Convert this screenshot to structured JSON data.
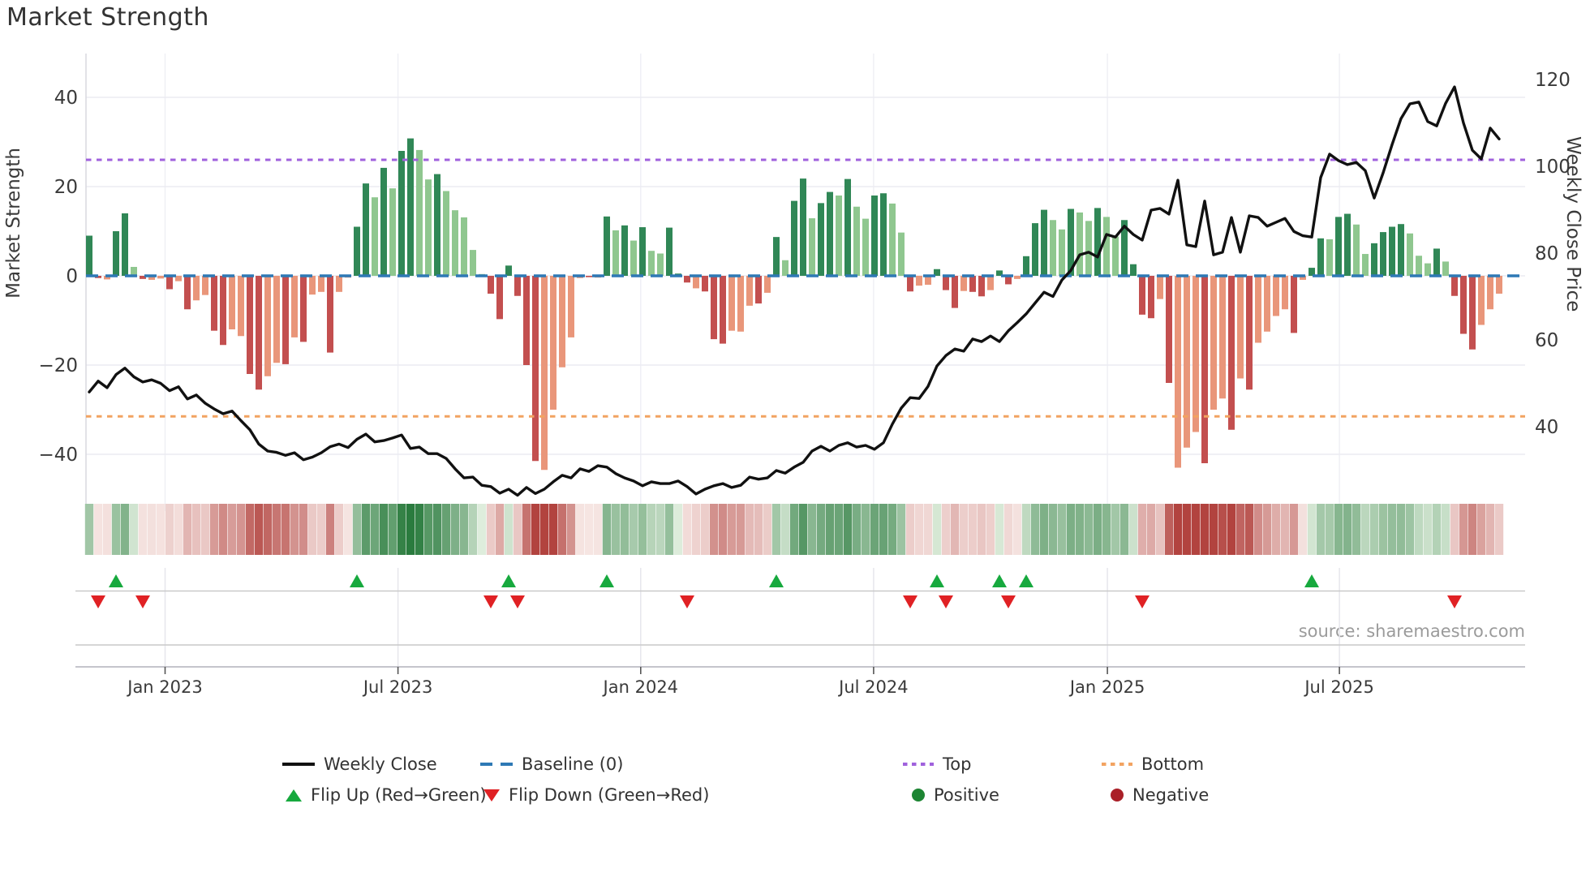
{
  "page": {
    "title": "Market Strength",
    "source": "source: sharemaestro.com"
  },
  "chart_data": {
    "type": "bar",
    "subtype": "combo-bar-line-heatmap",
    "title": "Market Strength",
    "left_axis": {
      "label": "Market Strength",
      "ticks": [
        40,
        20,
        0,
        -20,
        -40
      ],
      "tick_labels": [
        "40",
        "20",
        "0",
        "−20",
        "−40"
      ],
      "ylim": [
        -52,
        50
      ]
    },
    "right_axis": {
      "label": "Weekly Close Price",
      "ticks": [
        120,
        100,
        80,
        60,
        40
      ],
      "tick_labels": [
        "120",
        "100",
        "80",
        "60",
        "40"
      ],
      "ylim": [
        22,
        126
      ]
    },
    "x_axis": {
      "tick_labels": [
        "Jan 2023",
        "Jul 2023",
        "Jan 2024",
        "Jul 2024",
        "Jan 2025",
        "Jul 2025"
      ],
      "tick_weeks": [
        8.5,
        34.6,
        61.8,
        87.9,
        114.1,
        140.1
      ],
      "start_week_label": "Nov 2022",
      "weeks_total": 159
    },
    "reference_lines": {
      "baseline": 0,
      "top": 26,
      "bottom": -31.5
    },
    "bars": {
      "values": [
        9,
        -0.5,
        -0.8,
        10,
        14,
        2,
        -0.7,
        -0.9,
        -0.6,
        -3,
        -1.2,
        -7.5,
        -5.5,
        -4.3,
        -12.3,
        -15.5,
        -12,
        -13.5,
        -22,
        -25.5,
        -22.5,
        -19.5,
        -19.8,
        -13.8,
        -14.8,
        -4.2,
        -3.6,
        -17.2,
        -3.6,
        -0.4,
        11,
        20.7,
        17.6,
        24.2,
        19.6,
        28,
        30.8,
        28.2,
        21.6,
        22.8,
        19,
        14.7,
        13.1,
        5.8,
        0.4,
        -4,
        -9.7,
        2.3,
        -4.5,
        -20,
        -41.5,
        -43.5,
        -30,
        -20.5,
        -13.8,
        -0.5,
        -0.3,
        -0.4,
        13.3,
        10.2,
        11.3,
        7.9,
        10.9,
        5.6,
        5,
        10.8,
        0.5,
        -1.5,
        -2.8,
        -3.5,
        -14.2,
        -15.2,
        -12.3,
        -12.5,
        -6.7,
        -6.2,
        -3.8,
        8.7,
        3.5,
        16.8,
        21.8,
        12.9,
        16.3,
        18.8,
        18,
        21.7,
        15.5,
        12.8,
        18,
        18.5,
        16.2,
        9.7,
        -3.5,
        -2.2,
        -2,
        1.5,
        -3.2,
        -7.2,
        -3.4,
        -3.6,
        -4.6,
        -3.2,
        1.2,
        -1.9,
        -0.7,
        4.4,
        11.8,
        14.8,
        12.5,
        10.4,
        15,
        14.2,
        12.3,
        15.2,
        13.2,
        8.8,
        12.5,
        2.6,
        -8.7,
        -9.5,
        -5.2,
        -24,
        -43,
        -38.5,
        -35,
        -42,
        -30,
        -27.5,
        -34.5,
        -23,
        -25.5,
        -15,
        -12.5,
        -9,
        -7.5,
        -12.8,
        -0.9,
        1.8,
        8.4,
        8.2,
        13.2,
        13.9,
        11.5,
        4.9,
        7.3,
        9.8,
        11,
        11.6,
        9.5,
        4.5,
        2.8,
        6.1,
        3.2,
        -4.5,
        -13,
        -16.5,
        -11,
        -7.5,
        -4
      ],
      "shades": [
        "d",
        "d",
        "l",
        "d",
        "d",
        "l",
        "d",
        "l",
        "l",
        "d",
        "l",
        "d",
        "l",
        "l",
        "d",
        "d",
        "l",
        "l",
        "d",
        "d",
        "l",
        "l",
        "d",
        "l",
        "d",
        "l",
        "l",
        "d",
        "l",
        "l",
        "d",
        "d",
        "l",
        "d",
        "l",
        "d",
        "d",
        "l",
        "l",
        "d",
        "l",
        "l",
        "l",
        "l",
        "l",
        "d",
        "d",
        "d",
        "d",
        "d",
        "d",
        "l",
        "l",
        "l",
        "l",
        "l",
        "d",
        "l",
        "d",
        "l",
        "d",
        "l",
        "d",
        "l",
        "l",
        "d",
        "d",
        "d",
        "l",
        "d",
        "d",
        "d",
        "l",
        "l",
        "l",
        "d",
        "l",
        "d",
        "l",
        "d",
        "d",
        "l",
        "d",
        "d",
        "l",
        "d",
        "l",
        "l",
        "d",
        "d",
        "l",
        "l",
        "d",
        "l",
        "l",
        "d",
        "d",
        "d",
        "l",
        "d",
        "d",
        "l",
        "d",
        "d",
        "l",
        "d",
        "d",
        "d",
        "l",
        "l",
        "d",
        "l",
        "l",
        "d",
        "l",
        "l",
        "d",
        "d",
        "d",
        "d",
        "l",
        "d",
        "l",
        "l",
        "l",
        "d",
        "l",
        "l",
        "d",
        "l",
        "d",
        "l",
        "l",
        "l",
        "l",
        "d",
        "l",
        "d",
        "d",
        "l",
        "d",
        "d",
        "l",
        "l",
        "d",
        "d",
        "d",
        "d",
        "l",
        "l",
        "l",
        "d",
        "l",
        "d",
        "d",
        "d",
        "l",
        "l",
        "l"
      ]
    },
    "weekly_close": [
      48,
      50.5,
      49,
      52,
      53.5,
      51.5,
      50.3,
      50.8,
      50,
      48.3,
      49.2,
      46.4,
      47.3,
      45.4,
      44.1,
      43,
      43.6,
      41.4,
      39.3,
      36,
      34.4,
      34.1,
      33.4,
      34,
      32.4,
      33,
      34,
      35.4,
      36,
      35.2,
      37.1,
      38.3,
      36.5,
      36.8,
      37.4,
      38.1,
      35,
      35.3,
      33.8,
      33.8,
      32.7,
      30.3,
      28.2,
      28.4,
      26.5,
      26.2,
      24.7,
      25.6,
      24.2,
      26,
      24.6,
      25.6,
      27.3,
      28.8,
      28.2,
      30.3,
      29.7,
      31,
      30.7,
      29.2,
      28.2,
      27.5,
      26.4,
      27.3,
      26.9,
      26.9,
      27.5,
      26.2,
      24.5,
      25.6,
      26.4,
      26.9,
      26,
      26.5,
      28.4,
      27.9,
      28.2,
      29.9,
      29.3,
      30.7,
      31.8,
      34.4,
      35.5,
      34.4,
      35.7,
      36.3,
      35.3,
      35.7,
      34.8,
      36.3,
      40.6,
      44.3,
      46.7,
      46.5,
      49.3,
      54,
      56.4,
      57.9,
      57.4,
      60.2,
      59.6,
      60.9,
      59.6,
      62.1,
      64,
      66,
      68.5,
      71,
      70,
      73.8,
      76,
      79.6,
      80.2,
      79.1,
      84.3,
      83.7,
      86.2,
      84.3,
      83,
      89.9,
      90.3,
      89,
      96.8,
      81.9,
      81.5,
      92,
      79.6,
      80.2,
      88.2,
      80.2,
      88.6,
      88.2,
      86.2,
      87.1,
      88,
      85,
      84,
      83.7,
      97.4,
      102.8,
      101.3,
      100.4,
      100.9,
      99,
      92.7,
      98.5,
      105,
      111,
      114.4,
      114.8,
      110.3,
      109.3,
      114.5,
      118.3,
      110,
      103.7,
      101.7,
      108.8,
      106.3
    ],
    "flip_up_weeks": [
      3,
      30,
      47,
      58,
      77,
      95,
      102,
      105,
      137
    ],
    "flip_down_weeks": [
      1,
      6,
      45,
      48,
      67,
      92,
      96,
      103,
      118,
      153
    ],
    "legend": {
      "items": [
        {
          "label": "Weekly Close",
          "marker": "line-black"
        },
        {
          "label": "Baseline (0)",
          "marker": "dash-blue"
        },
        {
          "label": "Top",
          "marker": "dot-purple"
        },
        {
          "label": "Bottom",
          "marker": "dot-orange"
        },
        {
          "label": "Flip Up (Red→Green)",
          "marker": "triangle-up-green"
        },
        {
          "label": "Flip Down (Green→Red)",
          "marker": "triangle-down-red"
        },
        {
          "label": "Positive",
          "marker": "circle-green"
        },
        {
          "label": "Negative",
          "marker": "circle-darkred"
        }
      ]
    },
    "colors": {
      "bar_pos_dark": "#308756",
      "bar_pos_light": "#8fc78f",
      "bar_neg_dark": "#c34f4f",
      "bar_neg_light": "#e9967a",
      "baseline": "#2e79b5",
      "top_line": "#a061dd",
      "bottom_line": "#f2a361",
      "price_line": "#111111",
      "flip_up": "#17a93e",
      "flip_down": "#e02124",
      "positive_dot": "#1d8533",
      "negative_dot": "#aa2028",
      "heat_pos_dark": "#2a7b3e",
      "heat_pos_light": "#e3f0e0",
      "heat_neg_dark": "#b2433f",
      "heat_neg_light": "#f7e8e5",
      "grid": "#ebebf2",
      "spine": "#d8d8df",
      "separator": "#c9c9c9",
      "tick_text": "#3a3a3a"
    },
    "layout": {
      "grid": true,
      "legend_position": "bottom"
    }
  }
}
